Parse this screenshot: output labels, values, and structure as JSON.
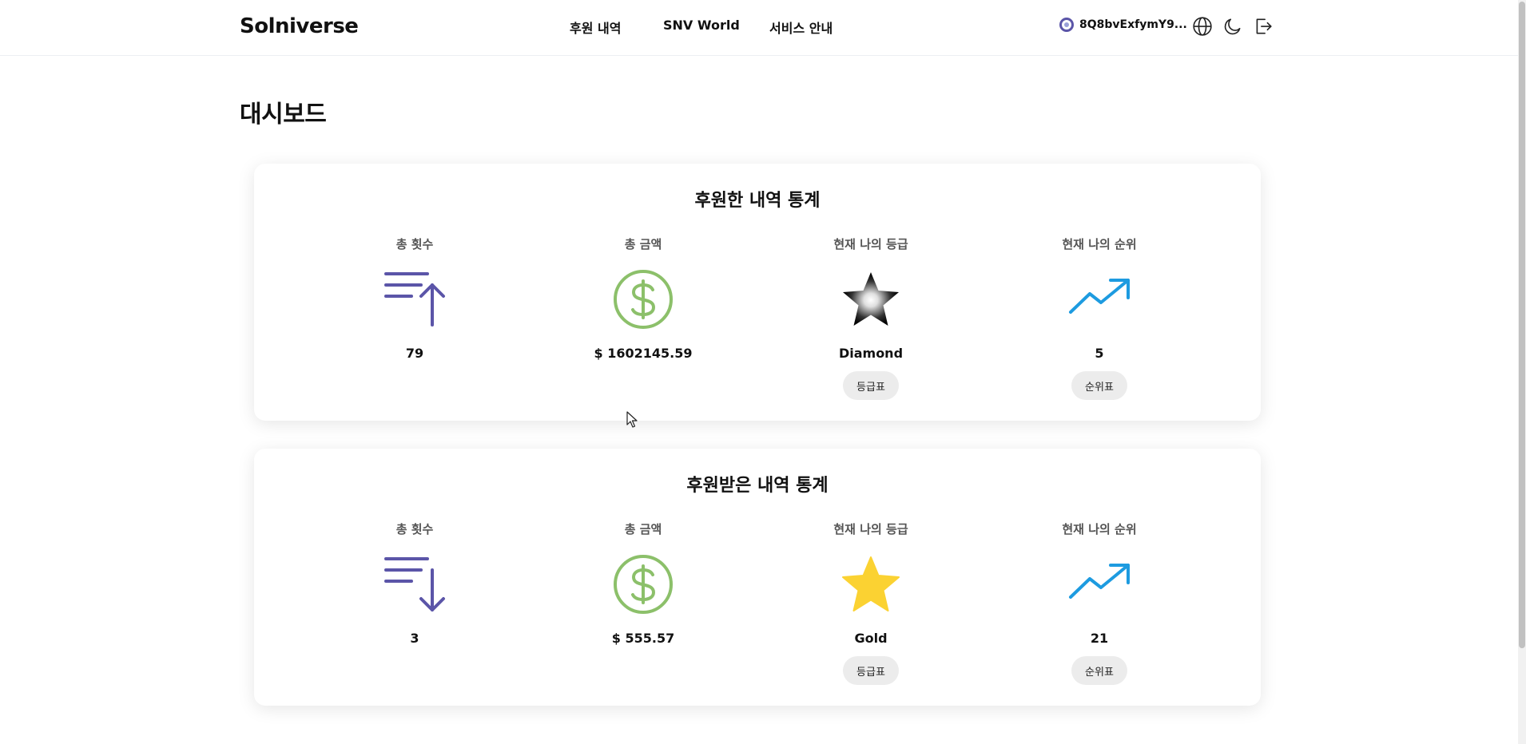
{
  "header": {
    "logo": "Solniverse",
    "nav": [
      {
        "label": "후원 내역"
      },
      {
        "label": "SNV World"
      },
      {
        "label": "서비스 안내"
      }
    ],
    "wallet_address": "8Q8bvExfymY9...",
    "icons": [
      "globe-icon",
      "moon-icon",
      "logout-icon"
    ]
  },
  "page": {
    "title": "대시보드"
  },
  "sent_stats": {
    "title": "후원한 내역 통계",
    "total_count": {
      "label": "총 횟수",
      "value": "79",
      "icon": "sort-up-icon"
    },
    "total_amount": {
      "label": "총 금액",
      "value": "$ 1602145.59",
      "icon": "dollar-circle-icon"
    },
    "grade": {
      "label": "현재 나의 등급",
      "value": "Diamond",
      "button": "등급표",
      "icon": "diamond-star-icon"
    },
    "rank": {
      "label": "현재 나의 순위",
      "value": "5",
      "button": "순위표",
      "icon": "trending-up-icon"
    }
  },
  "received_stats": {
    "title": "후원받은 내역 통계",
    "total_count": {
      "label": "총 횟수",
      "value": "3",
      "icon": "sort-down-icon"
    },
    "total_amount": {
      "label": "총 금액",
      "value": "$ 555.57",
      "icon": "dollar-circle-icon"
    },
    "grade": {
      "label": "현재 나의 등급",
      "value": "Gold",
      "button": "등급표",
      "icon": "gold-star-icon"
    },
    "rank": {
      "label": "현재 나의 순위",
      "value": "21",
      "button": "순위표",
      "icon": "trending-up-icon"
    }
  },
  "colors": {
    "sort_icon": "#5b55a8",
    "dollar_icon": "#8cc06a",
    "gold_star": "#fbd232",
    "trend_icon": "#1d9be0"
  }
}
